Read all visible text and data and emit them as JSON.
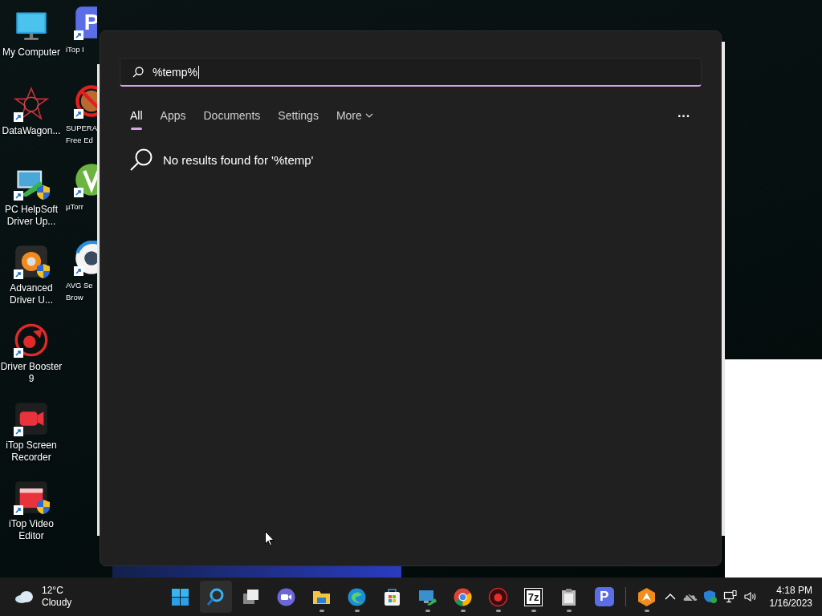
{
  "desktop": {
    "column_1": [
      {
        "kind": "monitor",
        "label": "My Computer",
        "shortcut": false,
        "shield": false
      },
      {
        "kind": "star",
        "label": "DataWagon...",
        "shortcut": true,
        "shield": false
      },
      {
        "kind": "helpsoft",
        "label": "PC HelpSoft Driver Up...",
        "shortcut": true,
        "shield": true
      },
      {
        "kind": "gear",
        "label": "Advanced Driver U...",
        "shortcut": true,
        "shield": true
      },
      {
        "kind": "booster",
        "label": "Driver Booster 9",
        "shortcut": true,
        "shield": false
      },
      {
        "kind": "recorder",
        "label": "iTop Screen Recorder",
        "shortcut": true,
        "shield": false
      },
      {
        "kind": "video",
        "label": "iTop Video Editor",
        "shortcut": true,
        "shield": true
      }
    ],
    "column_2": [
      {
        "kind": "pdf",
        "glyph": "P",
        "label": [
          "iTop I"
        ],
        "shortcut": true
      },
      {
        "kind": "nosign",
        "label": [
          "SUPERA",
          "Free Ed"
        ],
        "shortcut": true
      },
      {
        "kind": "torrent",
        "label": [
          "µTorr"
        ],
        "shortcut": true
      },
      {
        "kind": "avg",
        "label": [
          "AVG Se",
          "Brow"
        ],
        "shortcut": true
      }
    ]
  },
  "search_panel": {
    "query": "%temp%",
    "tabs": [
      {
        "label": "All",
        "selected": true
      },
      {
        "label": "Apps",
        "selected": false
      },
      {
        "label": "Documents",
        "selected": false
      },
      {
        "label": "Settings",
        "selected": false
      },
      {
        "label": "More",
        "selected": false,
        "dropdown": true
      }
    ],
    "more_options": "···",
    "message": "No results found for '%temp'"
  },
  "taskbar": {
    "weather": {
      "temperature": "12°C",
      "condition": "Cloudy"
    },
    "apps": [
      {
        "kind": "start",
        "running": false,
        "selected": false
      },
      {
        "kind": "search",
        "running": false,
        "selected": true
      },
      {
        "kind": "taskview",
        "running": false,
        "selected": false
      },
      {
        "kind": "chat",
        "running": false,
        "selected": false
      },
      {
        "kind": "folder",
        "running": true,
        "selected": false
      },
      {
        "kind": "edge",
        "running": true,
        "selected": false
      },
      {
        "kind": "store",
        "running": false,
        "selected": false
      },
      {
        "kind": "monitor",
        "running": true,
        "selected": false
      },
      {
        "kind": "chrome",
        "running": true,
        "selected": false
      },
      {
        "kind": "booster",
        "running": true,
        "selected": false
      },
      {
        "kind": "sevenzip",
        "glyph": "7z",
        "running": true,
        "selected": false
      },
      {
        "kind": "clipboard",
        "running": true,
        "selected": false
      },
      {
        "kind": "pdf",
        "glyph": "P",
        "running": false,
        "selected": false
      },
      {
        "kind": "separator"
      },
      {
        "kind": "avast",
        "running": true,
        "selected": false
      }
    ],
    "clock": {
      "time": "4:18 PM",
      "date": "1/16/2023"
    }
  }
}
